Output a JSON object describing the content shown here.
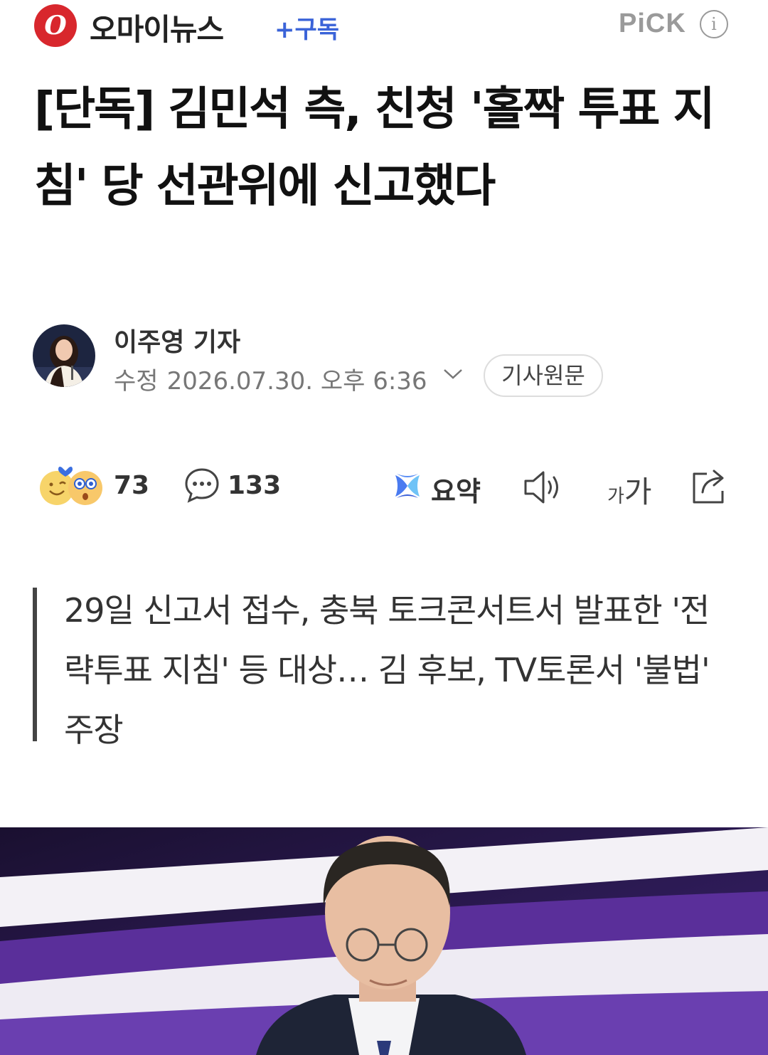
{
  "header": {
    "press_logo": "O",
    "press_name": "오마이뉴스",
    "subscribe_label": "+구독",
    "pick_label": "PiCK",
    "info_icon": "info-icon"
  },
  "article": {
    "headline": "[단독] 김민석 측, 친청 '홀짝 투표 지침' 당 선관위에 신고했다",
    "reporter": "이주영 기자",
    "modified_label": "수정",
    "modified_datetime": "2026.07.30. 오후 6:36",
    "original_button": "기사원문",
    "summary": "29일 신고서 접수, 충북 토크콘서트서 발표한 '전략투표 지침' 등 대상… 김 후보, TV토론서 '불법' 주장"
  },
  "actions": {
    "reaction_count": "73",
    "comment_count": "133",
    "summary_label": "요약",
    "font_small": "가",
    "font_big": "가",
    "icons": [
      "emoji-reaction-icon",
      "comment-icon",
      "summary-icon",
      "speaker-icon",
      "font-size-icon",
      "share-icon"
    ]
  },
  "colors": {
    "brand_red": "#d8272d",
    "subscribe_blue": "#3a63d8",
    "photo_purple": "#4b2a8c"
  }
}
